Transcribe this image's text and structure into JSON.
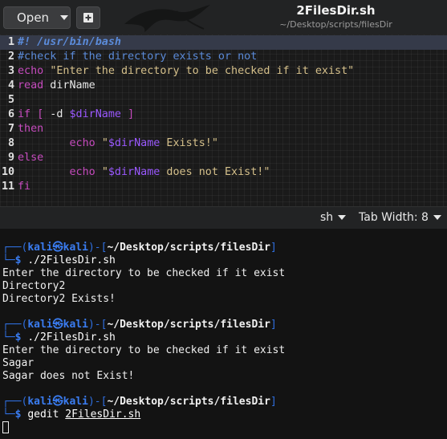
{
  "header": {
    "open_label": "Open",
    "title": "2FilesDir.sh",
    "subtitle": "~/Desktop/scripts/filesDir"
  },
  "editor": {
    "lines": [
      {
        "n": "1",
        "tokens": [
          {
            "t": "#! /usr/bin/bash",
            "c": "shebang"
          }
        ]
      },
      {
        "n": "2",
        "tokens": [
          {
            "t": "#check if the directory exists or not",
            "c": "comment"
          }
        ]
      },
      {
        "n": "3",
        "tokens": [
          {
            "t": "echo",
            "c": "kw"
          },
          {
            "t": " ",
            "c": "plain"
          },
          {
            "t": "\"Enter the directory to be checked if it exist\"",
            "c": "str"
          }
        ]
      },
      {
        "n": "4",
        "tokens": [
          {
            "t": "read",
            "c": "kw"
          },
          {
            "t": " dirName",
            "c": "plain"
          }
        ]
      },
      {
        "n": "5",
        "tokens": []
      },
      {
        "n": "6",
        "tokens": [
          {
            "t": "if",
            "c": "kw"
          },
          {
            "t": " ",
            "c": "plain"
          },
          {
            "t": "[",
            "c": "bracket"
          },
          {
            "t": " -d ",
            "c": "plain"
          },
          {
            "t": "$dirName",
            "c": "var"
          },
          {
            "t": " ",
            "c": "plain"
          },
          {
            "t": "]",
            "c": "bracket"
          }
        ]
      },
      {
        "n": "7",
        "tokens": [
          {
            "t": "then",
            "c": "kw"
          }
        ]
      },
      {
        "n": "8",
        "tokens": [
          {
            "t": "        ",
            "c": "plain"
          },
          {
            "t": "echo",
            "c": "kw"
          },
          {
            "t": " ",
            "c": "plain"
          },
          {
            "t": "\"",
            "c": "str"
          },
          {
            "t": "$dirName",
            "c": "var"
          },
          {
            "t": " Exists!\"",
            "c": "str"
          }
        ]
      },
      {
        "n": "9",
        "tokens": [
          {
            "t": "else",
            "c": "kw"
          }
        ]
      },
      {
        "n": "10",
        "tokens": [
          {
            "t": "        ",
            "c": "plain"
          },
          {
            "t": "echo",
            "c": "kw"
          },
          {
            "t": " ",
            "c": "plain"
          },
          {
            "t": "\"",
            "c": "str"
          },
          {
            "t": "$dirName",
            "c": "var"
          },
          {
            "t": " does not Exist!\"",
            "c": "str"
          }
        ]
      },
      {
        "n": "11",
        "tokens": [
          {
            "t": "fi",
            "c": "kw"
          }
        ]
      }
    ]
  },
  "statusbar": {
    "language": "sh",
    "tab_width": "Tab Width: 8"
  },
  "terminal": {
    "lines": [
      {
        "kind": "prompt",
        "user": "kali",
        "at": "㉿",
        "host": "kali",
        "path": "~/Desktop/scripts/filesDir"
      },
      {
        "kind": "cmd",
        "cmd": "./2FilesDir.sh"
      },
      {
        "kind": "out",
        "text": "Enter the directory to be checked if it exist"
      },
      {
        "kind": "out",
        "text": "Directory2"
      },
      {
        "kind": "out",
        "text": "Directory2 Exists!"
      },
      {
        "kind": "blank"
      },
      {
        "kind": "prompt",
        "user": "kali",
        "at": "㉿",
        "host": "kali",
        "path": "~/Desktop/scripts/filesDir"
      },
      {
        "kind": "cmd",
        "cmd": "./2FilesDir.sh"
      },
      {
        "kind": "out",
        "text": "Enter the directory to be checked if it exist"
      },
      {
        "kind": "out",
        "text": "Sagar"
      },
      {
        "kind": "out",
        "text": "Sagar does not Exist!"
      },
      {
        "kind": "blank"
      },
      {
        "kind": "prompt",
        "user": "kali",
        "at": "㉿",
        "host": "kali",
        "path": "~/Desktop/scripts/filesDir"
      },
      {
        "kind": "cmd2",
        "cmd": "gedit",
        "arg": "2FilesDir.sh"
      }
    ]
  }
}
